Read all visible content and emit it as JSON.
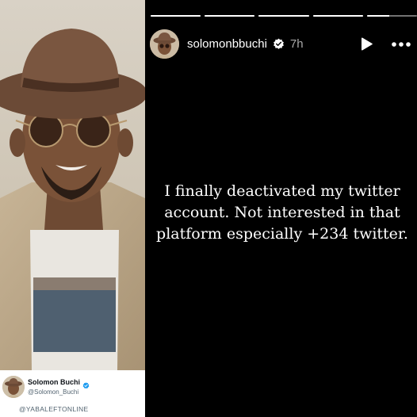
{
  "tweet_card": {
    "display_name": "Solomon Buchi",
    "handle": "@Solomon_Buchi",
    "verified_icon": "verified-badge-icon"
  },
  "watermark": "@YABALEFTONLINE",
  "story": {
    "username": "solomonbbuchi",
    "timestamp": "7h",
    "progress": [
      1,
      1,
      1,
      1,
      0.45
    ],
    "text": "I finally deactivated my twitter account. Not interested in that platform especially +234 twitter.",
    "icons": {
      "verified": "verified-badge-icon",
      "play": "play-icon",
      "more": "more-options-icon"
    }
  },
  "colors": {
    "story_background": "#000000",
    "twitter_verified": "#1d9bf0",
    "handle_gray": "#536471"
  }
}
